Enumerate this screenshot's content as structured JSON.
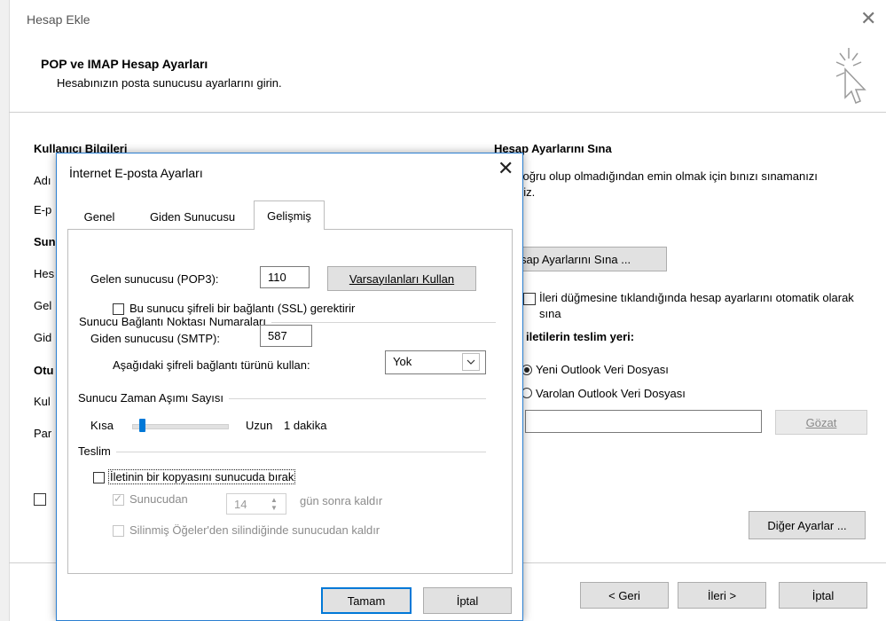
{
  "wizard": {
    "title": "Hesap Ekle",
    "header_title": "POP ve IMAP Hesap Ayarları",
    "header_subtitle": "Hesabınızın posta sunucusu ayarlarını girin.",
    "left_labels": [
      {
        "text": "Kullanıcı Bilgileri",
        "bold": true
      },
      {
        "text": "Adı",
        "bold": false
      },
      {
        "text": "E-p",
        "bold": false
      },
      {
        "text": "Sun",
        "bold": true
      },
      {
        "text": "Hes",
        "bold": false
      },
      {
        "text": "Gel",
        "bold": false
      },
      {
        "text": "Gid",
        "bold": false
      },
      {
        "text": "Otu",
        "bold": true
      },
      {
        "text": "Kul",
        "bold": false
      },
      {
        "text": "Par",
        "bold": false
      }
    ],
    "test_title": "Hesap Ayarlarını Sına",
    "test_desc": "erin doğru olup olmadığından emin olmak için bınızı sınamanızı öneririz.",
    "test_button": "sap Ayarlarını Sına ...",
    "auto_test_label": "İleri düğmesine tıklandığında hesap ayarlarını otomatik olarak sına",
    "deliver_title": "iletilerin teslim yeri:",
    "radio_new": "Yeni Outlook Veri Dosyası",
    "radio_existing": "Varolan Outlook Veri Dosyası",
    "browse_button": "Gözat",
    "more_settings_button": "Diğer Ayarlar ...",
    "back_button": "< Geri",
    "next_button": "İleri >",
    "cancel_button": "İptal"
  },
  "dialog": {
    "title": "İnternet E-posta Ayarları",
    "tabs": [
      "Genel",
      "Giden Sunucusu",
      "Gelişmiş"
    ],
    "active_tab": "Gelişmiş",
    "ports_group": "Sunucu Bağlantı Noktası Numaraları",
    "incoming_label": "Gelen sunucusu (POP3):",
    "incoming_port": "110",
    "defaults_button": "Varsayılanları Kullan",
    "ssl_label": "Bu sunucu şifreli bir bağlantı (SSL) gerektirir",
    "outgoing_label": "Giden sunucusu (SMTP):",
    "outgoing_port": "587",
    "encryption_label": "Aşağıdaki şifreli bağlantı türünü kullan:",
    "encryption_value": "Yok",
    "timeout_group": "Sunucu Zaman Aşımı Sayısı",
    "timeout_short": "Kısa",
    "timeout_long": "Uzun",
    "timeout_value": "1 dakika",
    "timeout_level": 0.08,
    "delivery_group": "Teslim",
    "keep_copy_label": "İletinin bir kopyasını sunucuda bırak",
    "remove_after_label": "Sunucudan",
    "remove_after_days": "14",
    "remove_after_suffix": "gün sonra kaldır",
    "remove_deleted_label": "Silinmiş Öğeler'den silindiğinde sunucudan kaldır",
    "ok_button": "Tamam",
    "cancel_button": "İptal"
  }
}
